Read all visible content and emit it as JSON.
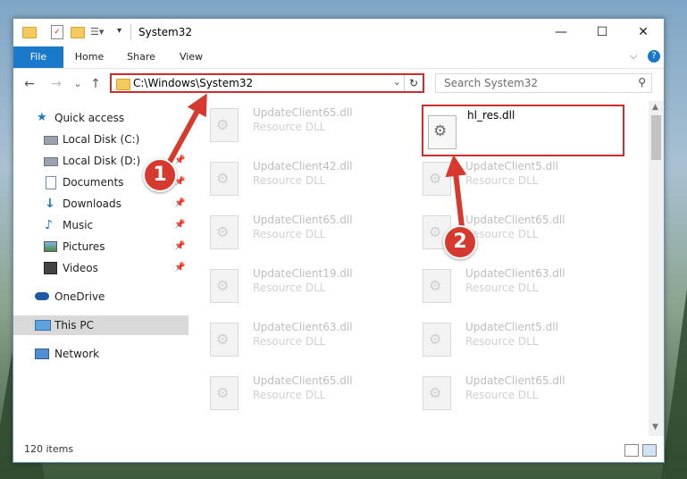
{
  "window": {
    "title": "System32",
    "controls": {
      "minimize": "—",
      "maximize": "☐",
      "close": "✕"
    }
  },
  "ribbon": {
    "tabs": [
      "File",
      "Home",
      "Share",
      "View"
    ],
    "chevron": "⌵",
    "help": "?"
  },
  "navigation": {
    "back": "←",
    "forward": "→",
    "recent": "⌄",
    "up": "↑",
    "address": "C:\\Windows\\System32",
    "refresh": "↻",
    "search_placeholder": "Search System32"
  },
  "sidebar": {
    "items": [
      {
        "label": "Quick access",
        "icon": "star-icon",
        "pinned": false
      },
      {
        "label": "Local Disk (C:)",
        "icon": "drive-icon",
        "pinned": false
      },
      {
        "label": "Local Disk (D:)",
        "icon": "drive-icon",
        "pinned": true
      },
      {
        "label": "Documents",
        "icon": "documents-icon",
        "pinned": true
      },
      {
        "label": "Downloads",
        "icon": "download-icon",
        "pinned": true
      },
      {
        "label": "Music",
        "icon": "music-icon",
        "pinned": true
      },
      {
        "label": "Pictures",
        "icon": "pictures-icon",
        "pinned": true
      },
      {
        "label": "Videos",
        "icon": "videos-icon",
        "pinned": true
      },
      {
        "label": "OneDrive",
        "icon": "cloud-icon",
        "pinned": false
      },
      {
        "label": "This PC",
        "icon": "computer-icon",
        "pinned": false,
        "selected": true
      },
      {
        "label": "Network",
        "icon": "network-icon",
        "pinned": false
      }
    ]
  },
  "files": {
    "left_column": [
      {
        "name": "UpdateClient65.dll",
        "desc": "Resource DLL"
      },
      {
        "name": "UpdateClient42.dll",
        "desc": "Resource DLL"
      },
      {
        "name": "UpdateClient65.dll",
        "desc": "Resource DLL"
      },
      {
        "name": "UpdateClient19.dll",
        "desc": "Resource DLL"
      },
      {
        "name": "UpdateClient63.dll",
        "desc": "Resource DLL"
      },
      {
        "name": "UpdateClient65.dll",
        "desc": "Resource DLL"
      }
    ],
    "right_column": [
      {
        "name": "UpdateClient5.dll",
        "desc": "Resource DLL"
      },
      {
        "name": "UpdateClient65.dll",
        "desc": "Resource DLL"
      },
      {
        "name": "UpdateClient63.dll",
        "desc": "Resource DLL"
      },
      {
        "name": "UpdateClient5.dll",
        "desc": "Resource DLL"
      },
      {
        "name": "UpdateClient65.dll",
        "desc": "Resource DLL"
      }
    ],
    "highlighted": {
      "name": "hl_res.dll"
    }
  },
  "status": {
    "item_count": "120 items"
  },
  "callouts": {
    "one": "1",
    "two": "2"
  },
  "colors": {
    "accent": "#1979ca",
    "highlight": "#d12b2b",
    "callout": "#d63a2f"
  }
}
